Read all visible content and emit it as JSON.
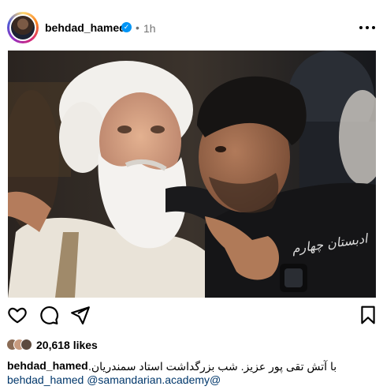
{
  "post": {
    "username": "behdad_hamed",
    "verified_icon": "verified-badge-icon",
    "separator": "•",
    "time": "1h",
    "more_icon": "more-options-icon"
  },
  "image": {
    "watermark_text": "ادبستان چهارم",
    "description_icon": "photo"
  },
  "actions": {
    "like_icon": "heart-icon",
    "comment_icon": "comment-icon",
    "share_icon": "share-icon",
    "save_icon": "bookmark-icon"
  },
  "likes": {
    "count_text": "20,618 likes"
  },
  "caption": {
    "username": "behdad_hamed",
    "text": "با آتش تقی پور عزیز. شب بزرگداشت استاد سمندریان."
  },
  "second_line": {
    "text": "behdad_hamed @samandarian.academy@"
  },
  "colors": {
    "link": "#00376b",
    "verified": "#0095f6",
    "muted": "#737373"
  }
}
